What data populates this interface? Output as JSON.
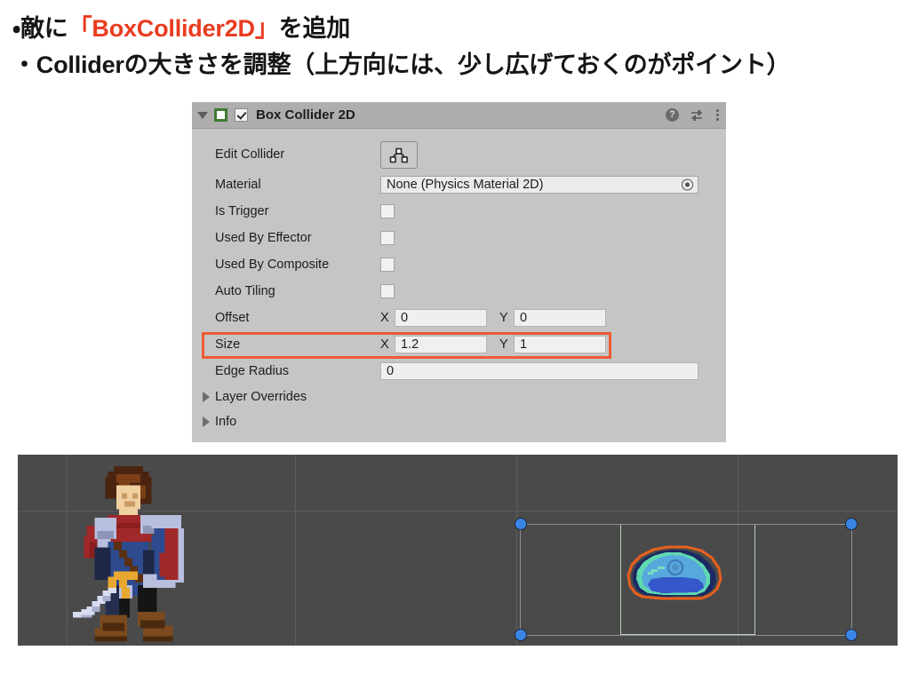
{
  "headline": {
    "line1_pre": "・敵に",
    "line1_accent": "「BoxCollider2D」",
    "line1_post": "を追加",
    "line2": "・Colliderの大きさを調整（上方向には、少し広げておくのがポイント）",
    "accent_color": "#ea3b1e"
  },
  "inspector": {
    "component_title": "Box Collider 2D",
    "enabled": "checked",
    "header_icons": {
      "help": "?",
      "help_name": "help-icon",
      "settings_name": "settings-sliders-icon",
      "menu_name": "kebab-menu-icon"
    },
    "rows": {
      "edit_collider_label": "Edit Collider",
      "edit_collider_icon": "polygon-edit-icon",
      "material_label": "Material",
      "material_value": "None (Physics Material 2D)",
      "is_trigger_label": "Is Trigger",
      "is_trigger_value": "unchecked",
      "used_by_effector_label": "Used By Effector",
      "used_by_effector_value": "unchecked",
      "used_by_composite_label": "Used By Composite",
      "used_by_composite_value": "unchecked",
      "auto_tiling_label": "Auto Tiling",
      "auto_tiling_value": "unchecked",
      "offset_label": "Offset",
      "offset_x_axis": "X",
      "offset_x_value": "0",
      "offset_y_axis": "Y",
      "offset_y_value": "0",
      "size_label": "Size",
      "size_x_axis": "X",
      "size_x_value": "1.2",
      "size_y_axis": "Y",
      "size_y_value": "1",
      "edge_radius_label": "Edge Radius",
      "edge_radius_value": "0",
      "layer_overrides_label": "Layer Overrides",
      "info_label": "Info"
    },
    "highlight_color": "#ec5a33",
    "panel_bg": "#c5c5c5",
    "header_bg": "#aeaeae",
    "component_icon_color": "#3f7a33"
  },
  "scene": {
    "background": "#4a4a4a",
    "grid_color": "#5b5b5b",
    "knight_name": "knight-player-sprite",
    "slime_name": "slime-enemy-sprite",
    "collider_outline_color": "#e8601c",
    "collider_box_color": "#b9d3b7",
    "handle_color": "#3a84e6",
    "selection_line_color": "#8d8d8d"
  }
}
